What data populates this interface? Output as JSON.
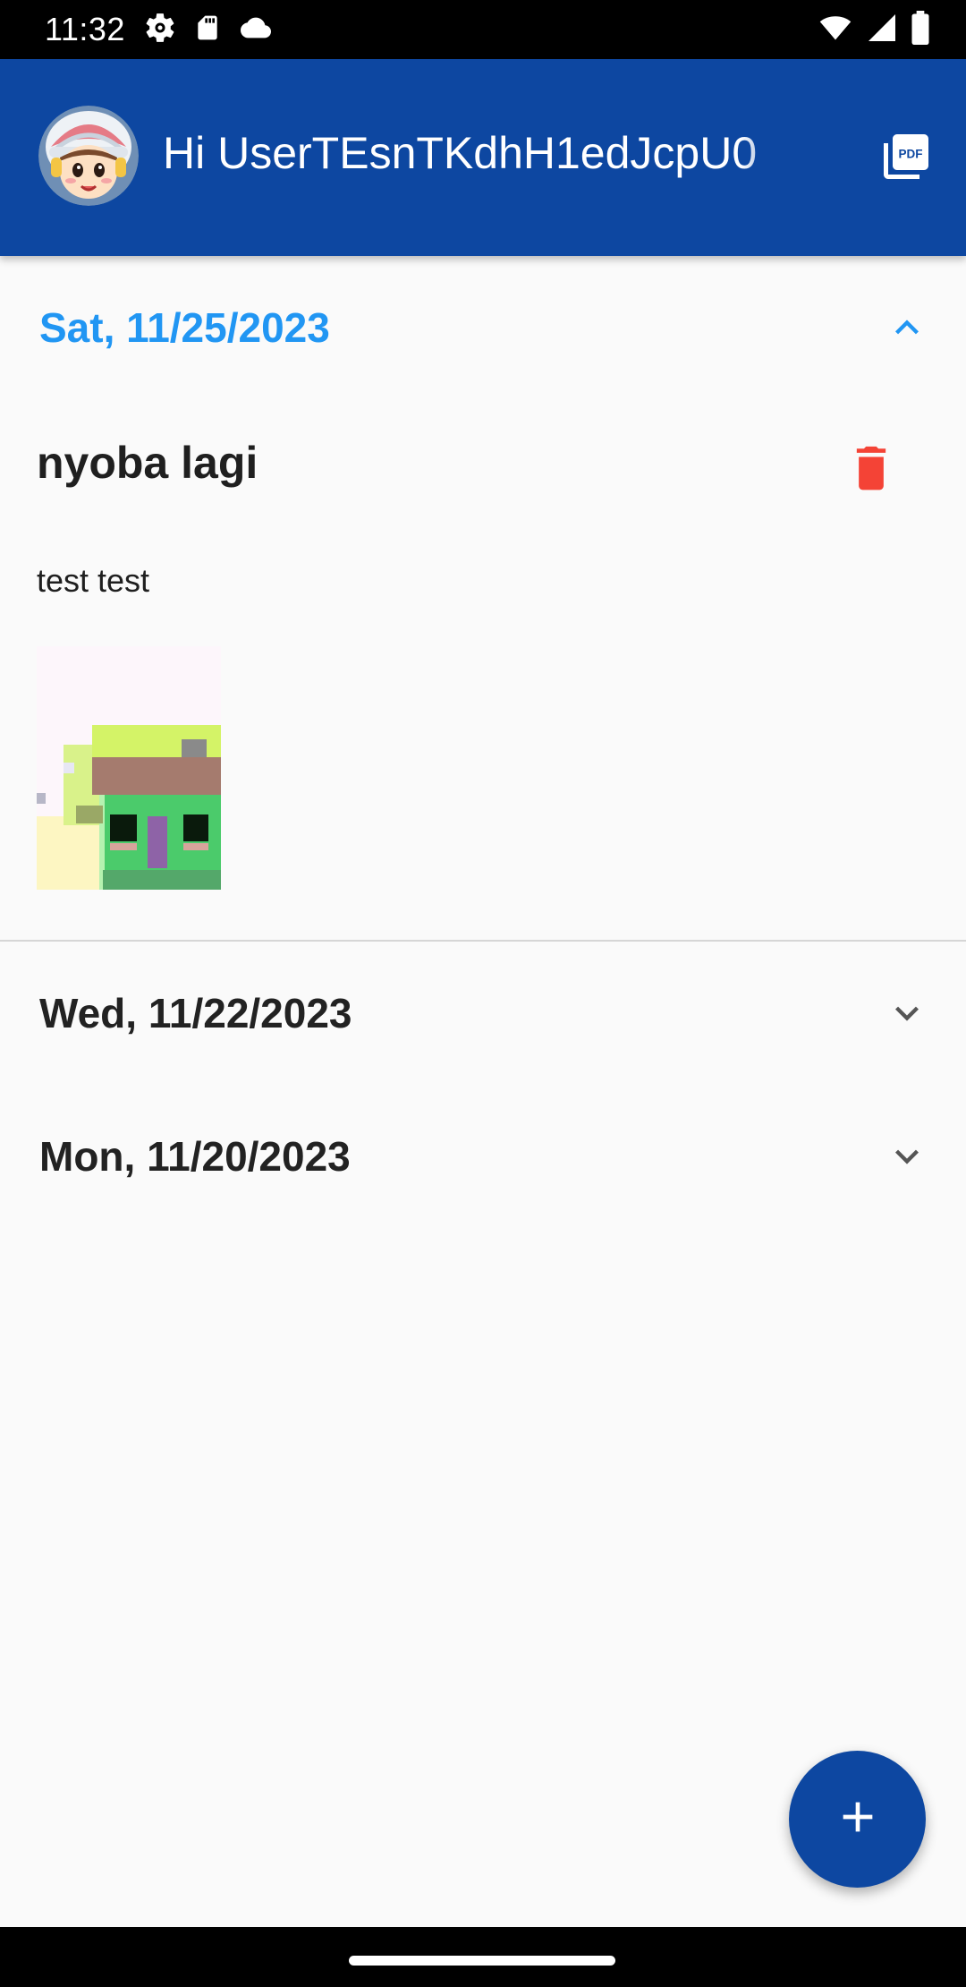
{
  "status_bar": {
    "time": "11:32",
    "icons": [
      "settings-icon",
      "sd-card-icon",
      "cloud-icon",
      "wifi-icon",
      "signal-icon",
      "battery-icon"
    ]
  },
  "app_bar": {
    "greeting": "Hi UserTEsnTKdhH1edJcpU0",
    "pdf_icon": "pdf-icon",
    "avatar": "avatar-character"
  },
  "colors": {
    "primary": "#0d47a1",
    "accent": "#2196f3",
    "delete": "#f44336",
    "background": "#fafafa"
  },
  "sections": [
    {
      "date": "Sat, 11/25/2023",
      "expanded": true,
      "notes": [
        {
          "title": "nyoba lagi",
          "body": "test test",
          "has_image": true
        }
      ]
    },
    {
      "date": "Wed, 11/22/2023",
      "expanded": false
    },
    {
      "date": "Mon, 11/20/2023",
      "expanded": false
    }
  ],
  "fab": {
    "icon": "add-icon"
  }
}
